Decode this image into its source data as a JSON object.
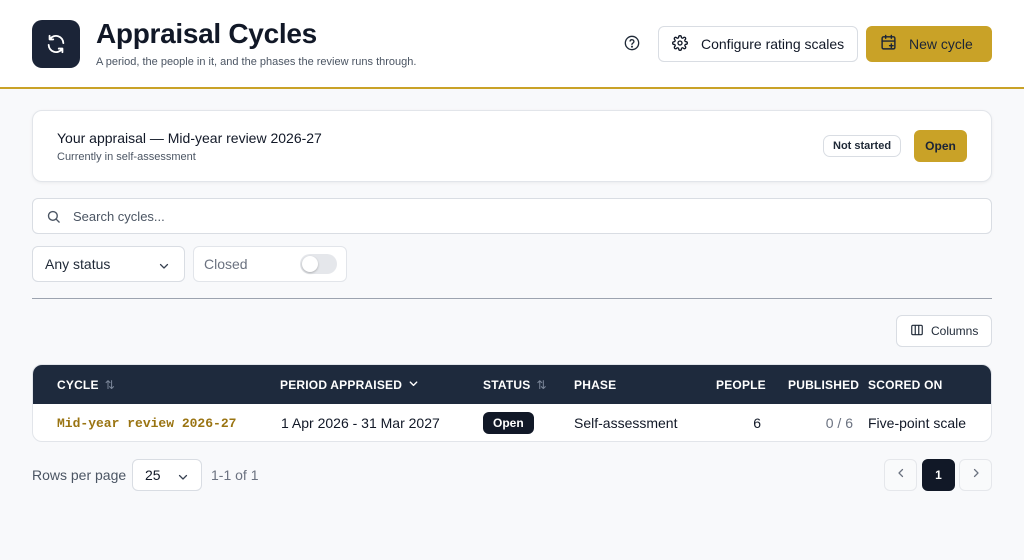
{
  "header": {
    "title": "Appraisal Cycles",
    "subtitle": "A period, the people in it, and the phases the review runs through.",
    "app_icon": "refresh-cycle-icon",
    "help_icon": "help-circle-icon",
    "configure_label": "Configure rating scales",
    "configure_icon": "gear-icon",
    "new_cycle_label": "New cycle",
    "new_cycle_icon": "calendar-plus-icon"
  },
  "appraisal": {
    "title": "Your appraisal — Mid-year review 2026-27",
    "subtitle": "Currently in self-assessment",
    "badge": "Not started",
    "action_label": "Open"
  },
  "search": {
    "placeholder": "Search cycles...",
    "value": "",
    "icon": "search-icon"
  },
  "filters": {
    "status_value": "Any status",
    "closed_label": "Closed",
    "closed_on": false
  },
  "columns_button": {
    "label": "Columns",
    "icon": "columns-icon"
  },
  "table": {
    "headers": {
      "cycle": "CYCLE",
      "period": "PERIOD APPRAISED",
      "status": "STATUS",
      "phase": "PHASE",
      "people": "PEOPLE",
      "published": "PUBLISHED",
      "scored_on": "SCORED ON"
    },
    "sort_icon": "⇅",
    "rows": [
      {
        "cycle": "Mid-year review 2026-27",
        "period": "1 Apr 2026 - 31 Mar 2027",
        "status": "Open",
        "phase": "Self-assessment",
        "people": "6",
        "published": "0 / 6",
        "scored_on": "Five-point scale"
      }
    ]
  },
  "pagination": {
    "rows_label": "Rows per page",
    "rows_value": "25",
    "range": "1-1 of 1",
    "current_page": "1"
  },
  "colors": {
    "accent": "#c9a227",
    "navy": "#1b2437",
    "table_header": "#1e2a3d",
    "link": "#9a7412"
  }
}
